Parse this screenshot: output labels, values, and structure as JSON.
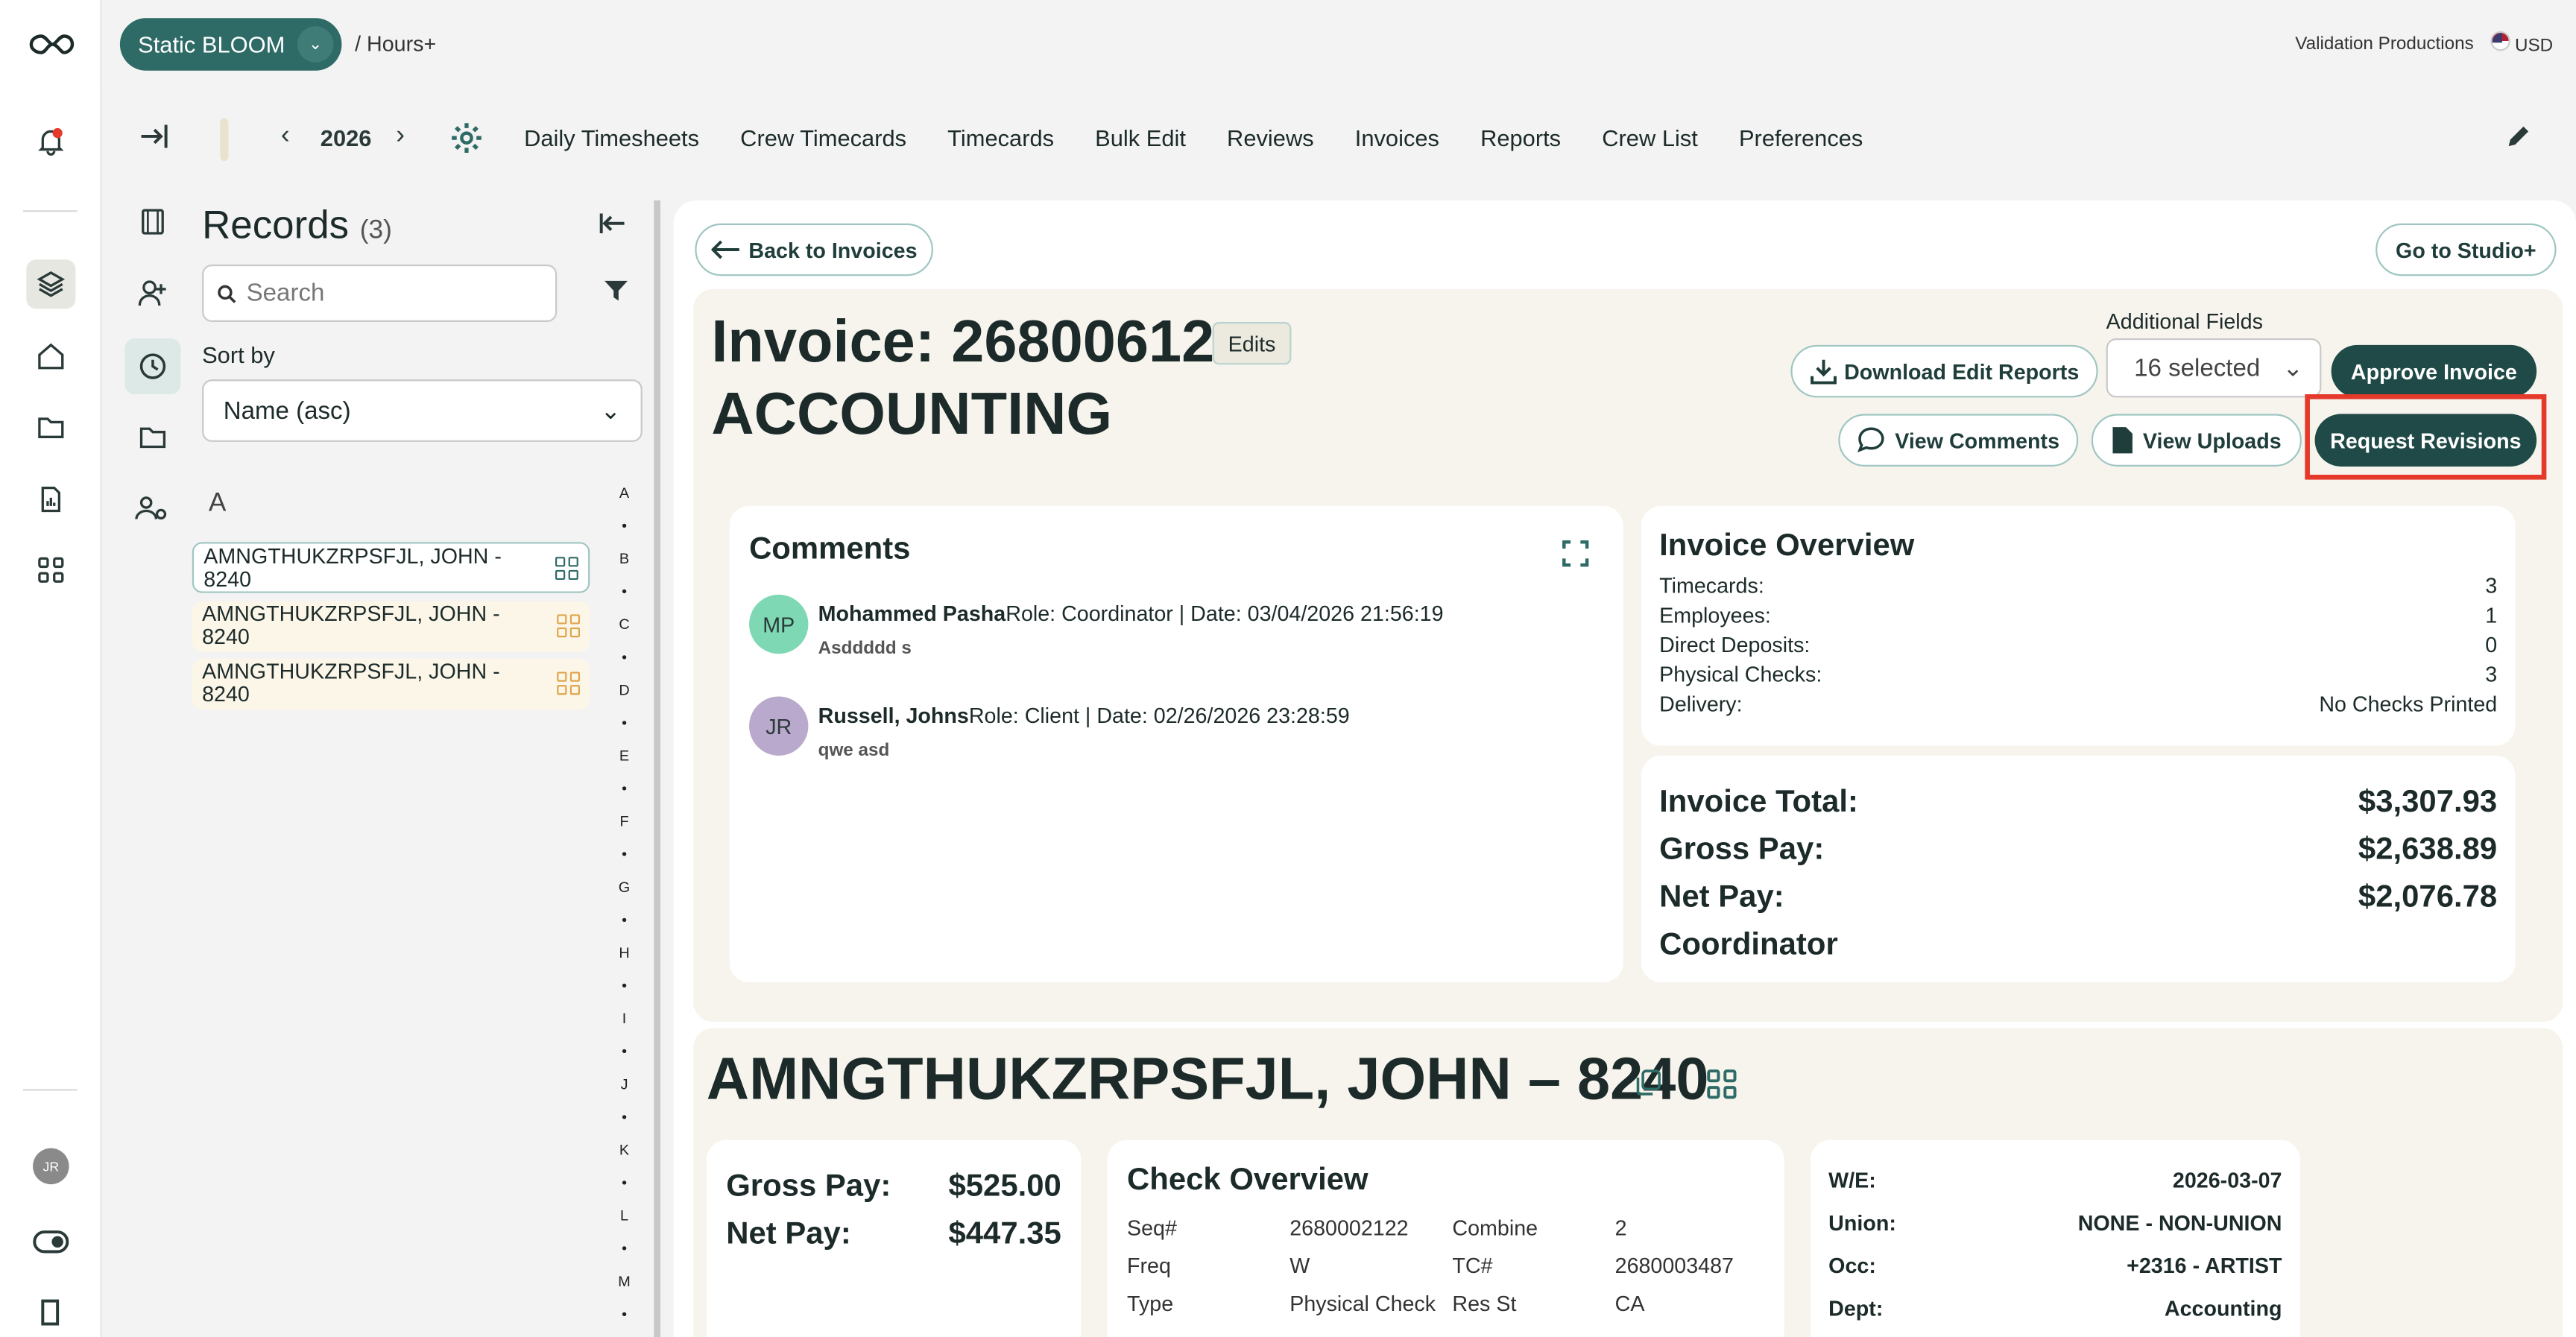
{
  "topbar": {
    "project": "Static BLOOM",
    "breadcrumb": "/ Hours+",
    "org": "Validation Productions",
    "currency": "USD"
  },
  "nav": {
    "year": "2026",
    "links": [
      "Daily Timesheets",
      "Crew Timecards",
      "Timecards",
      "Bulk Edit",
      "Reviews",
      "Invoices",
      "Reports",
      "Crew List",
      "Preferences"
    ]
  },
  "rail": {
    "user_initials": "JR"
  },
  "records": {
    "title": "Records",
    "count": "(3)",
    "search_placeholder": "Search",
    "sort_label": "Sort by",
    "sort_value": "Name (asc)",
    "group_letter": "A",
    "items": [
      {
        "name": "AMNGTHUKZRPSFJL, JOHN -",
        "id": "8240"
      },
      {
        "name": "AMNGTHUKZRPSFJL, JOHN -",
        "id": "8240"
      },
      {
        "name": "AMNGTHUKZRPSFJL, JOHN -",
        "id": "8240"
      }
    ],
    "alphabet": [
      "A",
      "•",
      "B",
      "•",
      "C",
      "•",
      "D",
      "•",
      "E",
      "•",
      "F",
      "•",
      "G",
      "•",
      "H",
      "•",
      "I",
      "•",
      "J",
      "•",
      "K",
      "•",
      "L",
      "•",
      "M",
      "•"
    ]
  },
  "main": {
    "back_label": "Back to Invoices",
    "studio_label": "Go to Studio+",
    "invoice_title": "Invoice: 26800612",
    "invoice_subtitle": "ACCOUNTING",
    "edits_label": "Edits",
    "download_label": "Download Edit Reports",
    "additional_fields_label": "Additional Fields",
    "additional_fields_value": "16 selected",
    "approve_label": "Approve Invoice",
    "comments_btn_label": "View Comments",
    "uploads_label": "View Uploads",
    "revisions_label": "Request Revisions"
  },
  "comments": {
    "title": "Comments",
    "items": [
      {
        "initials": "MP",
        "author": "Mohammed Pasha",
        "meta": "Role: Coordinator | Date: 03/04/2026 21:56:19",
        "body": "Asddddd s",
        "color": "#7fd8b4"
      },
      {
        "initials": "JR",
        "author": "Russell, Johns",
        "meta": "Role: Client | Date: 02/26/2026 23:28:59",
        "body": "qwe asd",
        "color": "#b9a9cc"
      }
    ]
  },
  "overview": {
    "title": "Invoice Overview",
    "rows": [
      {
        "label": "Timecards:",
        "value": "3"
      },
      {
        "label": "Employees:",
        "value": "1"
      },
      {
        "label": "Direct Deposits:",
        "value": "0"
      },
      {
        "label": "Physical Checks:",
        "value": "3"
      },
      {
        "label": "Delivery:",
        "value": "No Checks Printed"
      }
    ]
  },
  "totals": {
    "rows": [
      {
        "label": "Invoice Total:",
        "value": "$3,307.93"
      },
      {
        "label": "Gross Pay:",
        "value": "$2,638.89"
      },
      {
        "label": "Net Pay:",
        "value": "$2,076.78"
      },
      {
        "label": "Coordinator",
        "value": ""
      }
    ]
  },
  "employee": {
    "title": "AMNGTHUKZRPSFJL, JOHN – 8240",
    "gross_label": "Gross Pay:",
    "gross_value": "$525.00",
    "net_label": "Net Pay:",
    "net_value": "$447.35",
    "check_title": "Check Overview",
    "check_grid": [
      "Seq#",
      "2680002122",
      "Combine",
      "2",
      "Freq",
      "W",
      "TC#",
      "2680003487",
      "Type",
      "Physical Check",
      "Res St",
      "CA"
    ],
    "we_rows": [
      {
        "label": "W/E:",
        "value": "2026-03-07"
      },
      {
        "label": "Union:",
        "value": "NONE - NON-UNION"
      },
      {
        "label": "Occ:",
        "value": "+2316 - ARTIST"
      },
      {
        "label": "Dept:",
        "value": "Accounting"
      }
    ]
  },
  "colors": {
    "brand": "#2e6a66",
    "dark_button": "#1f4a47",
    "highlight": "#e53a2b"
  }
}
